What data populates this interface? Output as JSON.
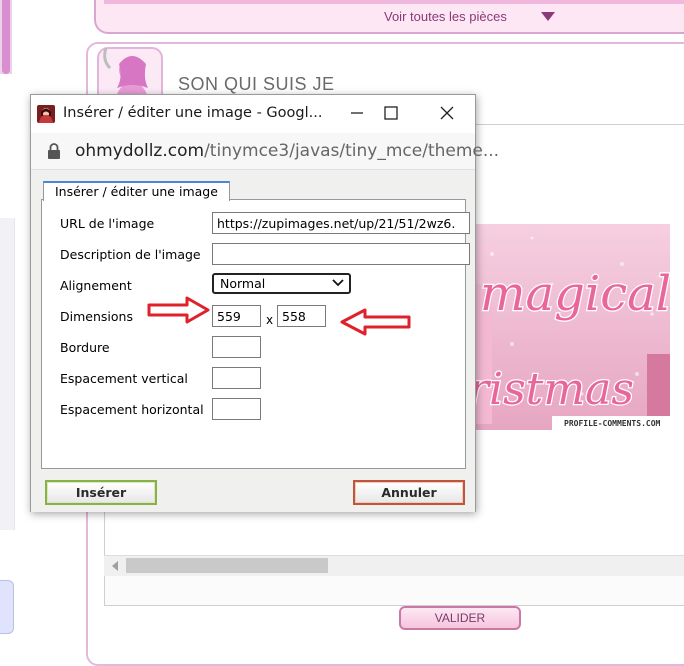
{
  "background": {
    "see_all_label": "Voir toutes les pièces",
    "section_title": "SON QUI SUIS JE",
    "image_caption": "PROFILE-COMMENTS.COM",
    "image_word1": "magical",
    "image_word2": "ristmas",
    "submit_label": "VALIDER"
  },
  "window": {
    "title": "Insérer / éditer une image - Googl...",
    "url_domain": "ohmydollz.com",
    "url_path": "/tinymce3/javas/tiny_mce/theme..."
  },
  "dialog": {
    "tab_label": "Insérer / éditer une image",
    "fields": {
      "image_url": {
        "label": "URL de l'image",
        "value": "https://zupimages.net/up/21/51/2wz6.",
        "placeholder": ""
      },
      "description": {
        "label": "Description de l'image",
        "value": "",
        "placeholder": ""
      },
      "alignment": {
        "label": "Alignement",
        "value": "Normal"
      },
      "dimensions": {
        "label": "Dimensions",
        "width": "559",
        "height": "558",
        "separator": "x"
      },
      "border": {
        "label": "Bordure",
        "value": ""
      },
      "vspace": {
        "label": "Espacement vertical",
        "value": ""
      },
      "hspace": {
        "label": "Espacement horizontal",
        "value": ""
      }
    },
    "insert_label": "Insérer",
    "cancel_label": "Annuler"
  },
  "colors": {
    "annotation_arrow": "#e0202a",
    "insert_border": "#8ab04a",
    "cancel_border": "#c0553c",
    "accent_pink": "#d98fcf"
  },
  "icons": {
    "favicon": "doll-favicon-icon",
    "minimize": "minimize-icon",
    "maximize": "maximize-icon",
    "close": "close-icon",
    "lock": "lock-icon",
    "dropdown": "chevron-down-icon"
  }
}
